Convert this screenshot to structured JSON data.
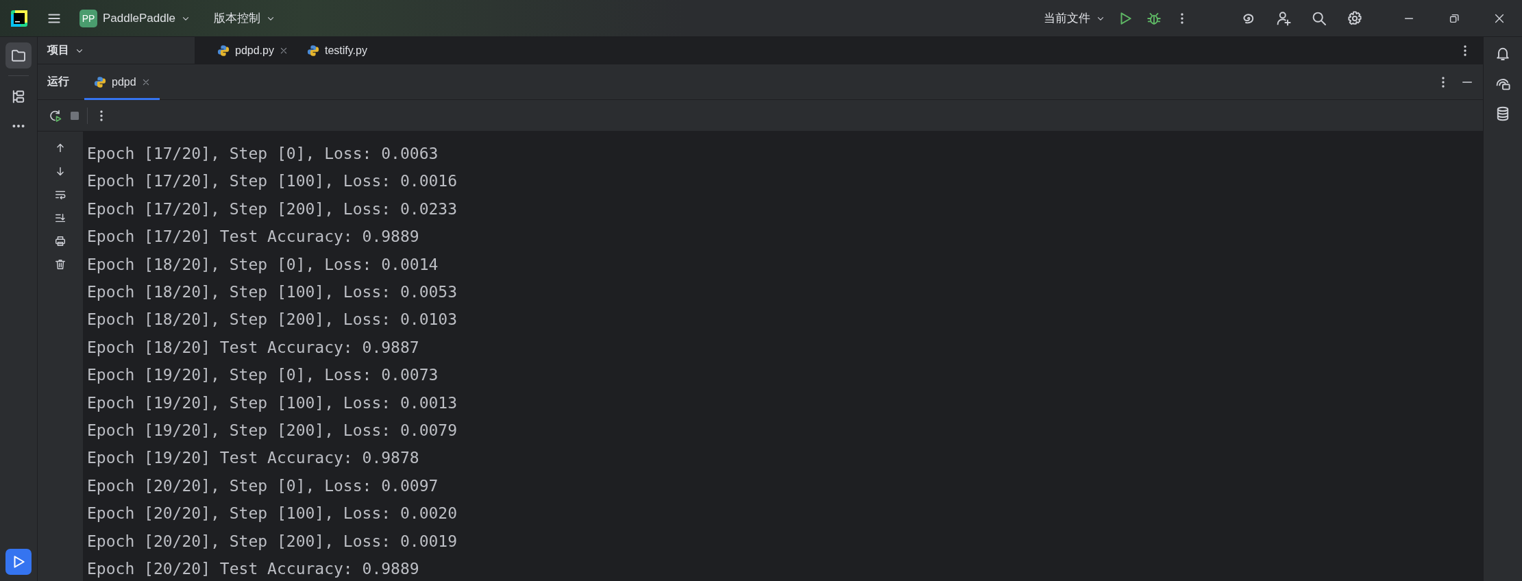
{
  "title_bar": {
    "project_badge": "PP",
    "project": "PaddlePaddle",
    "vcs": "版本控制",
    "run_config": "当前文件"
  },
  "project_panel": {
    "title": "项目"
  },
  "editor_tabs": [
    {
      "label": "pdpd.py",
      "closable": true
    },
    {
      "label": "testify.py",
      "closable": false
    }
  ],
  "run_panel": {
    "title": "运行",
    "tabs": [
      {
        "label": "pdpd",
        "selected": true
      }
    ]
  },
  "console": {
    "lines": [
      "Epoch [17/20], Step [0], Loss: 0.0063",
      "Epoch [17/20], Step [100], Loss: 0.0016",
      "Epoch [17/20], Step [200], Loss: 0.0233",
      "Epoch [17/20] Test Accuracy: 0.9889",
      "Epoch [18/20], Step [0], Loss: 0.0014",
      "Epoch [18/20], Step [100], Loss: 0.0053",
      "Epoch [18/20], Step [200], Loss: 0.0103",
      "Epoch [18/20] Test Accuracy: 0.9887",
      "Epoch [19/20], Step [0], Loss: 0.0073",
      "Epoch [19/20], Step [100], Loss: 0.0013",
      "Epoch [19/20], Step [200], Loss: 0.0079",
      "Epoch [19/20] Test Accuracy: 0.9878",
      "Epoch [20/20], Step [0], Loss: 0.0097",
      "Epoch [20/20], Step [100], Loss: 0.0020",
      "Epoch [20/20], Step [200], Loss: 0.0019",
      "Epoch [20/20] Test Accuracy: 0.9889"
    ]
  }
}
